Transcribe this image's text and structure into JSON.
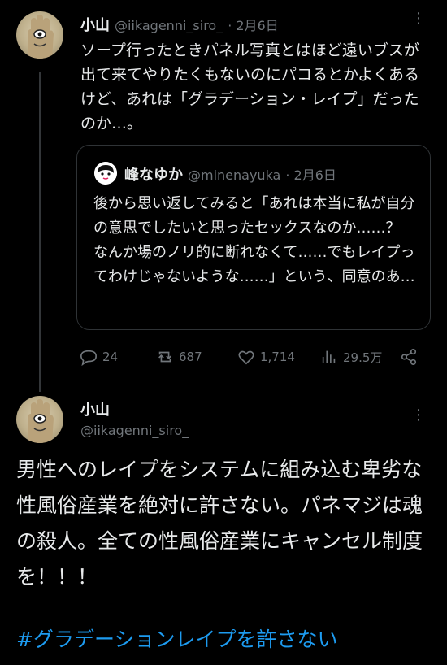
{
  "tweet1": {
    "name": "小山",
    "handle": "@iikagenni_siro_",
    "date": "· 2月6日",
    "text": "ソープ行ったときパネル写真とはほど遠いブスが出て来てやりたくもないのにパコるとかよくあるけど、あれは「グラデーション・レイプ」だったのか…。",
    "quote": {
      "name": "峰なゆか",
      "handle": "@minenayuka",
      "date": "· 2月6日",
      "text": "後から思い返してみると「あれは本当に私が自分の意思でしたいと思ったセックスなのか……？　なんか場のノリ的に断れなくて……でもレイプってわけじゃないような……」という、同意のあ…"
    },
    "stats": {
      "replies": "24",
      "retweets": "687",
      "likes": "1,714",
      "views": "29.5万"
    }
  },
  "tweet2": {
    "name": "小山",
    "handle": "@iikagenni_siro_",
    "text": "男性へのレイプをシステムに組み込む卑劣な性風俗産業を絶対に許さない。パネマジは魂の殺人。全ての性風俗産業にキャンセル制度を！！！",
    "hashtag": "#グラデーションレイプを許さない"
  },
  "icons": {
    "more": "more-icon",
    "reply": "reply-icon",
    "retweet": "retweet-icon",
    "like": "heart-icon",
    "views": "views-icon",
    "share": "share-icon"
  },
  "colors": {
    "background": "#000000",
    "text": "#e7e9ea",
    "muted": "#71767b",
    "link": "#1d9bf0"
  }
}
